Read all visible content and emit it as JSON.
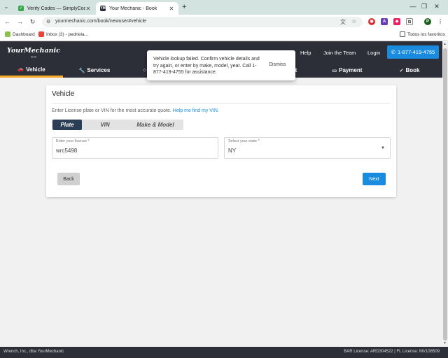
{
  "browser": {
    "tabs": [
      {
        "title": "Verify Codes — SimplyCodes",
        "active": false
      },
      {
        "title": "Your Mechanic - Book",
        "active": true
      }
    ],
    "url": "yourmechanic.com/book/newuser#vehicle",
    "bookmarks": [
      {
        "label": "Dashboard"
      },
      {
        "label": "Inbox (3) - pedriela..."
      }
    ],
    "all_bookmarks_label": "Todos los favoritos",
    "profile_initial": "P"
  },
  "site": {
    "logo_text": "YourMechanic",
    "top_links": [
      "Help",
      "Join the Team",
      "Login"
    ],
    "phone_label": "1-877-419-4755",
    "steps": [
      {
        "label": "Vehicle",
        "icon": "car-icon",
        "active": true
      },
      {
        "label": "Services",
        "icon": "wrench-icon",
        "active": false
      },
      {
        "label": "Payment",
        "icon": "card-icon",
        "active": false
      },
      {
        "label": "Book",
        "icon": "check-icon",
        "active": false
      }
    ],
    "partial_step_fragment": "t"
  },
  "toast": {
    "message": "Vehicle lookup failed. Confirm vehicle details and try again, or enter by make, model, year. Call 1-877-419-4755 for assistance.",
    "dismiss_label": "Dismiss"
  },
  "vehicle_card": {
    "title": "Vehicle",
    "hint_text": "Enter License plate or VIN for the most accurate quote.",
    "help_link": "Help me find my VIN.",
    "segments": [
      {
        "label": "Plate",
        "selected": true
      },
      {
        "label": "VIN",
        "selected": false
      },
      {
        "label": "Make & Model",
        "selected": false
      }
    ],
    "license_label": "Enter your license *",
    "license_value": "wrc5498",
    "state_label": "Select your state *",
    "state_value": "NY",
    "back_label": "Back",
    "next_label": "Next"
  },
  "footer": {
    "left": "Wrench, Inc., dba YourMechanic",
    "right": "BAR License: ARD304522 | FL License: MV108509"
  },
  "colors": {
    "header_bg": "#2c2f38",
    "accent_blue": "#1a8ce0",
    "active_step_underline": "#f5a623",
    "segment_selected": "#2c3e55"
  }
}
